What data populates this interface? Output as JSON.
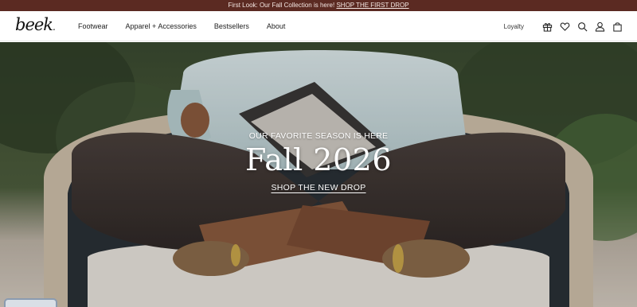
{
  "announcement": {
    "text": "First Look: Our Fall Collection is here!",
    "link": "SHOP THE FIRST DROP"
  },
  "brand": {
    "logo_text": "beek",
    "logo_dot": "."
  },
  "nav": {
    "items": [
      {
        "label": "Footwear"
      },
      {
        "label": "Apparel + Accessories"
      },
      {
        "label": "Bestsellers"
      },
      {
        "label": "About"
      }
    ]
  },
  "utility": {
    "loyalty_label": "Loyalty",
    "icons": [
      "gift-icon",
      "heart-icon",
      "search-icon",
      "account-icon",
      "bag-icon"
    ]
  },
  "hero": {
    "eyebrow": "OUR FAVORITE SEASON IS HERE",
    "headline": "Fall 2026",
    "cta": "SHOP THE NEW DROP"
  },
  "colors": {
    "announcement_bg": "#5b2a22",
    "text_dark": "#222222",
    "hero_text": "#ffffff"
  }
}
